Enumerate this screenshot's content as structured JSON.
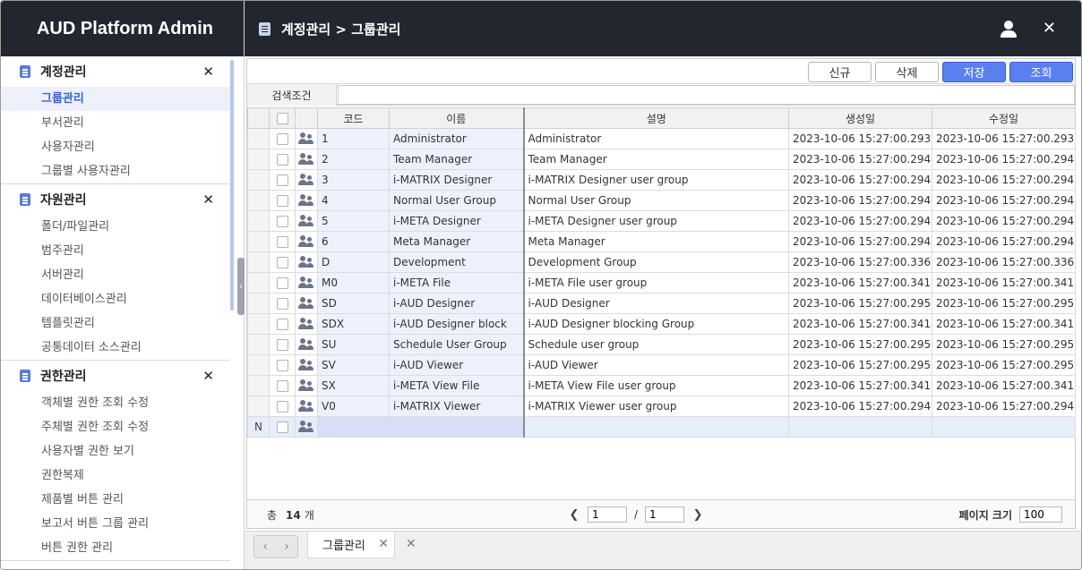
{
  "app": {
    "title": "AUD Platform Admin"
  },
  "header": {
    "breadcrumb": "계정관리 > 그룹관리"
  },
  "sidebar": {
    "sections": [
      {
        "title": "계정관리",
        "items": [
          "그룹관리",
          "부서관리",
          "사용자관리",
          "그룹별 사용자관리"
        ]
      },
      {
        "title": "자원관리",
        "items": [
          "폴더/파일관리",
          "범주관리",
          "서버관리",
          "데이터베이스관리",
          "템플릿관리",
          "공통데이터 소스관리"
        ]
      },
      {
        "title": "권한관리",
        "items": [
          "객체별 권한 조회 수정",
          "주체별 권한 조회 수정",
          "사용자별 권한 보기",
          "권한복제",
          "제품별 버튼 관리",
          "보고서 버튼 그룹 관리",
          "버튼 권한 관리"
        ]
      }
    ]
  },
  "toolbar": {
    "new_label": "신규",
    "delete_label": "삭제",
    "save_label": "저장",
    "search_label": "조회"
  },
  "search": {
    "label": "검색조건",
    "value": ""
  },
  "table": {
    "columns": {
      "code": "코드",
      "name": "이름",
      "desc": "설명",
      "created": "생성일",
      "modified": "수정일"
    },
    "rows": [
      {
        "code": "1",
        "name": "Administrator",
        "desc": "Administrator",
        "created": "2023-10-06 15:27:00.293",
        "modified": "2023-10-06 15:27:00.293"
      },
      {
        "code": "2",
        "name": "Team Manager",
        "desc": "Team Manager",
        "created": "2023-10-06 15:27:00.294",
        "modified": "2023-10-06 15:27:00.294"
      },
      {
        "code": "3",
        "name": "i-MATRIX Designer",
        "desc": "i-MATRIX Designer user group",
        "created": "2023-10-06 15:27:00.294",
        "modified": "2023-10-06 15:27:00.294"
      },
      {
        "code": "4",
        "name": "Normal User Group",
        "desc": "Normal User Group",
        "created": "2023-10-06 15:27:00.294",
        "modified": "2023-10-06 15:27:00.294"
      },
      {
        "code": "5",
        "name": "i-META Designer",
        "desc": "i-META Designer user group",
        "created": "2023-10-06 15:27:00.294",
        "modified": "2023-10-06 15:27:00.294"
      },
      {
        "code": "6",
        "name": "Meta Manager",
        "desc": "Meta Manager",
        "created": "2023-10-06 15:27:00.294",
        "modified": "2023-10-06 15:27:00.294"
      },
      {
        "code": "D",
        "name": "Development",
        "desc": "Development Group",
        "created": "2023-10-06 15:27:00.336",
        "modified": "2023-10-06 15:27:00.336"
      },
      {
        "code": "M0",
        "name": "i-META File",
        "desc": "i-META File user group",
        "created": "2023-10-06 15:27:00.341",
        "modified": "2023-10-06 15:27:00.341"
      },
      {
        "code": "SD",
        "name": "i-AUD Designer",
        "desc": "i-AUD Designer",
        "created": "2023-10-06 15:27:00.295",
        "modified": "2023-10-06 15:27:00.295"
      },
      {
        "code": "SDX",
        "name": "i-AUD Designer block",
        "desc": "i-AUD Designer blocking Group",
        "created": "2023-10-06 15:27:00.341",
        "modified": "2023-10-06 15:27:00.341"
      },
      {
        "code": "SU",
        "name": "Schedule User Group",
        "desc": "Schedule user group",
        "created": "2023-10-06 15:27:00.295",
        "modified": "2023-10-06 15:27:00.295"
      },
      {
        "code": "SV",
        "name": "i-AUD Viewer",
        "desc": "i-AUD Viewer",
        "created": "2023-10-06 15:27:00.295",
        "modified": "2023-10-06 15:27:00.295"
      },
      {
        "code": "SX",
        "name": "i-META View File",
        "desc": "i-META View File user group",
        "created": "2023-10-06 15:27:00.341",
        "modified": "2023-10-06 15:27:00.341"
      },
      {
        "code": "V0",
        "name": "i-MATRIX Viewer",
        "desc": "i-MATRIX Viewer user group",
        "created": "2023-10-06 15:27:00.294",
        "modified": "2023-10-06 15:27:00.294"
      }
    ],
    "new_row_indicator": "N"
  },
  "footer": {
    "total_prefix": "총",
    "total_count": "14",
    "total_suffix": "개",
    "current_page": "1",
    "page_sep": "/",
    "total_pages": "1",
    "page_size_label": "페이지 크기",
    "page_size": "100"
  },
  "tabs": [
    {
      "label": "그룹관리"
    }
  ],
  "icons": {
    "prev": "chevron-left-icon",
    "next": "chevron-right-icon",
    "close": "close-icon",
    "user": "user-icon",
    "group": "group-icon"
  },
  "colors": {
    "header_bg": "#24262f",
    "accent": "#5a80f0",
    "active_menu": "#3c63d4"
  }
}
